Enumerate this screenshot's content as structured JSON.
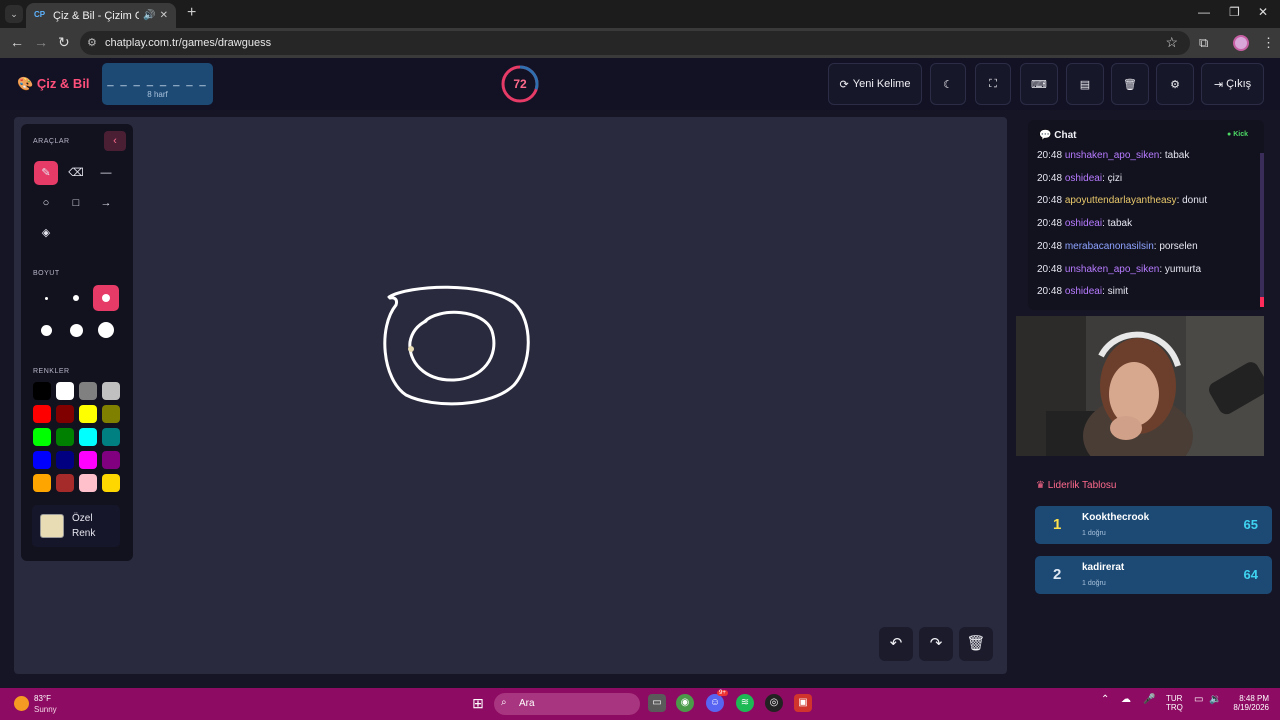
{
  "browser": {
    "tab_title": "Çiz & Bil - Çizim Oyunu",
    "tab_favicon": "CP",
    "url": "chatplay.com.tr/games/drawguess"
  },
  "header": {
    "logo": "Çiz & Bil",
    "word_mask": "_ _ _ _ _ _ _ _",
    "word_length": "8 harf",
    "timer": "72",
    "timer_fraction": 0.3,
    "new_word_label": "Yeni Kelime",
    "exit_label": "Çıkış"
  },
  "tools": {
    "tools_title": "ARAÇLAR",
    "size_title": "BOYUT",
    "colors_title": "RENKLER",
    "custom_color_line1": "Özel",
    "custom_color_line2": "Renk",
    "custom_color": "#e8dcb5",
    "swatches": [
      "#000000",
      "#ffffff",
      "#808080",
      "#c0c0c0",
      "#ff0000",
      "#800000",
      "#ffff00",
      "#808000",
      "#00ff00",
      "#008000",
      "#00ffff",
      "#008080",
      "#0000ff",
      "#000080",
      "#ff00ff",
      "#800080",
      "#ffa500",
      "#a52a2a",
      "#ffc0cb",
      "#ffd700"
    ]
  },
  "chat": {
    "title": "Chat",
    "platform": "Kick",
    "messages": [
      {
        "time": "20:48",
        "user": "unshaken_apo_siken",
        "text": ": tabak"
      },
      {
        "time": "20:48",
        "user": "oshideai",
        "text": ": çizi"
      },
      {
        "time": "20:48",
        "user": "apoyuttendarlayantheasy",
        "text": ": donut"
      },
      {
        "time": "20:48",
        "user": "oshideai",
        "text": ": tabak"
      },
      {
        "time": "20:48",
        "user": "merabacanonasilsin",
        "text": ": porselen"
      },
      {
        "time": "20:48",
        "user": "unshaken_apo_siken",
        "text": ": yumurta"
      },
      {
        "time": "20:48",
        "user": "oshideai",
        "text": ": simit"
      }
    ]
  },
  "leaderboard": {
    "title": "Liderlik Tablosu",
    "rows": [
      {
        "rank": "1",
        "name": "Kookthecrook",
        "sub": "1 doğru",
        "score": "65"
      },
      {
        "rank": "2",
        "name": "kadirerat",
        "sub": "1 doğru",
        "score": "64"
      }
    ]
  },
  "taskbar": {
    "temp": "83°F",
    "condition": "Sunny",
    "search_placeholder": "Ara",
    "discord_badge": "9+",
    "lang1": "TUR",
    "lang2": "TRQ",
    "time": "8:48 PM",
    "date": "8/19/2026"
  }
}
